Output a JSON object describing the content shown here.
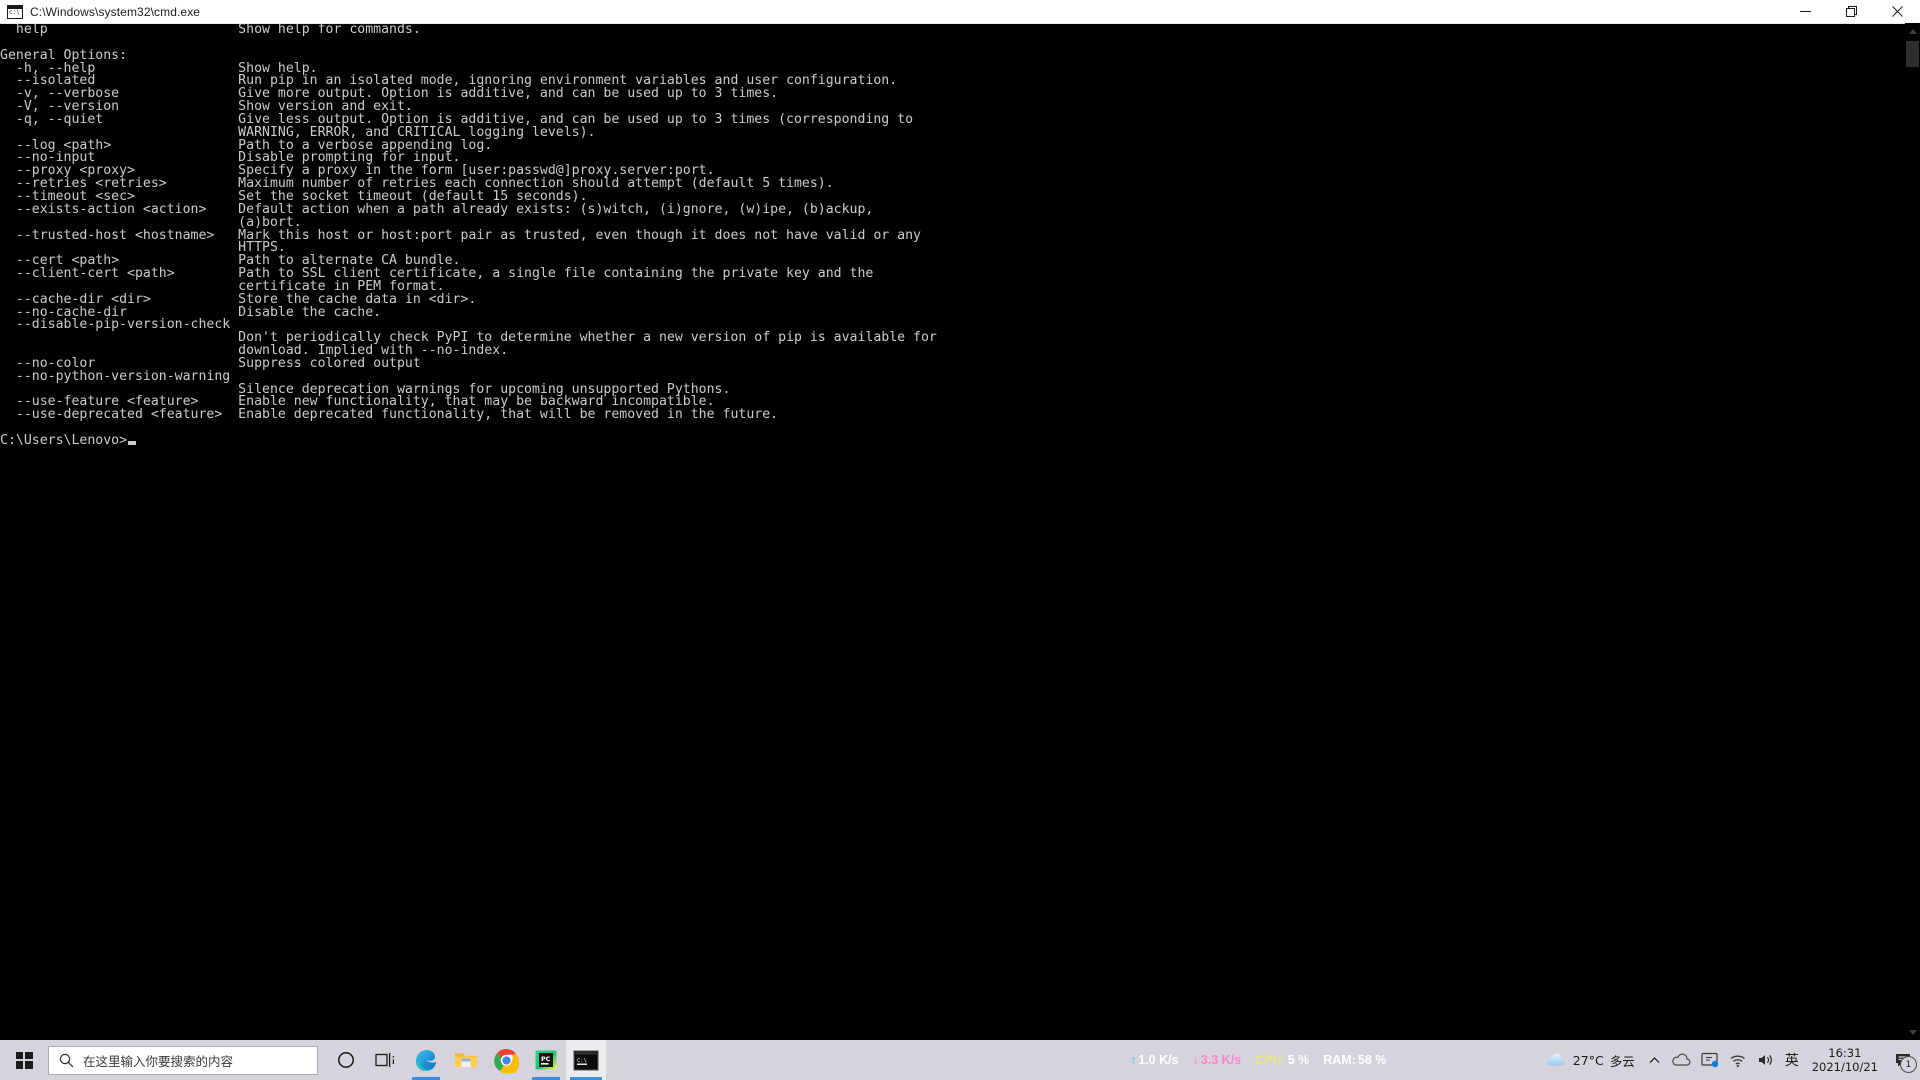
{
  "window": {
    "title": "C:\\Windows\\system32\\cmd.exe",
    "icon": "cmd-icon",
    "controls": {
      "minimize": "minimize-button",
      "maximize": "maximize-button",
      "close": "close-button"
    }
  },
  "terminal": {
    "background": "#000000",
    "foreground": "#cccccc",
    "prompt": "C:\\Users\\Lenovo>",
    "lines": [
      "  help                        Show help for commands.",
      "",
      "General Options:",
      "  -h, --help                  Show help.",
      "  --isolated                  Run pip in an isolated mode, ignoring environment variables and user configuration.",
      "  -v, --verbose               Give more output. Option is additive, and can be used up to 3 times.",
      "  -V, --version               Show version and exit.",
      "  -q, --quiet                 Give less output. Option is additive, and can be used up to 3 times (corresponding to",
      "                              WARNING, ERROR, and CRITICAL logging levels).",
      "  --log <path>                Path to a verbose appending log.",
      "  --no-input                  Disable prompting for input.",
      "  --proxy <proxy>             Specify a proxy in the form [user:passwd@]proxy.server:port.",
      "  --retries <retries>         Maximum number of retries each connection should attempt (default 5 times).",
      "  --timeout <sec>             Set the socket timeout (default 15 seconds).",
      "  --exists-action <action>    Default action when a path already exists: (s)witch, (i)gnore, (w)ipe, (b)ackup,",
      "                              (a)bort.",
      "  --trusted-host <hostname>   Mark this host or host:port pair as trusted, even though it does not have valid or any",
      "                              HTTPS.",
      "  --cert <path>               Path to alternate CA bundle.",
      "  --client-cert <path>        Path to SSL client certificate, a single file containing the private key and the",
      "                              certificate in PEM format.",
      "  --cache-dir <dir>           Store the cache data in <dir>.",
      "  --no-cache-dir              Disable the cache.",
      "  --disable-pip-version-check",
      "                              Don't periodically check PyPI to determine whether a new version of pip is available for",
      "                              download. Implied with --no-index.",
      "  --no-color                  Suppress colored output",
      "  --no-python-version-warning",
      "                              Silence deprecation warnings for upcoming unsupported Pythons.",
      "  --use-feature <feature>     Enable new functionality, that may be backward incompatible.",
      "  --use-deprecated <feature>  Enable deprecated functionality, that will be removed in the future.",
      ""
    ]
  },
  "taskbar": {
    "start": "windows-start-button",
    "search": {
      "placeholder": "在这里输入你要搜索的内容",
      "icon": "search-icon"
    },
    "apps": [
      {
        "name": "cortana",
        "label": "Cortana",
        "state": "idle"
      },
      {
        "name": "task-view",
        "label": "任务视图",
        "state": "idle"
      },
      {
        "name": "microsoft-edge",
        "label": "Microsoft Edge",
        "state": "running"
      },
      {
        "name": "file-explorer",
        "label": "文件资源管理器",
        "state": "idle"
      },
      {
        "name": "google-chrome",
        "label": "Google Chrome",
        "state": "idle"
      },
      {
        "name": "pycharm",
        "label": "PyCharm",
        "state": "running"
      },
      {
        "name": "command-prompt",
        "label": "命令提示符",
        "state": "focused"
      }
    ],
    "sysmon": [
      {
        "name": "upload-speed",
        "icon": "↑",
        "label": "",
        "value": "1.0 K/s",
        "color": "#19d6e0",
        "value_color": "#ffffff"
      },
      {
        "name": "download-speed",
        "icon": "↓",
        "label": "",
        "value": "3.3 K/s",
        "color": "#ff7fd0",
        "value_color": "#ff7fd0"
      },
      {
        "name": "cpu-usage",
        "icon": "",
        "label": "CPU:",
        "value": "5 %",
        "color": "#e8e87a",
        "value_color": "#ffffff"
      },
      {
        "name": "ram-usage",
        "icon": "",
        "label": "RAM:",
        "value": "58 %",
        "color": "#ffffff",
        "value_color": "#ffffff"
      }
    ],
    "tray": {
      "weather": {
        "temp": "27°C",
        "desc": "多云",
        "icon": "cloud-icon"
      },
      "show_hidden": "chevron-up-icon",
      "onedrive": "onedrive-cloud-icon",
      "screen_share": "screen-share-icon",
      "network": "wifi-icon",
      "volume": "speaker-icon",
      "ime": "英",
      "clock": {
        "time": "16:31",
        "date": "2021/10/21"
      },
      "notifications": {
        "icon": "notification-icon",
        "count": "1"
      }
    }
  }
}
